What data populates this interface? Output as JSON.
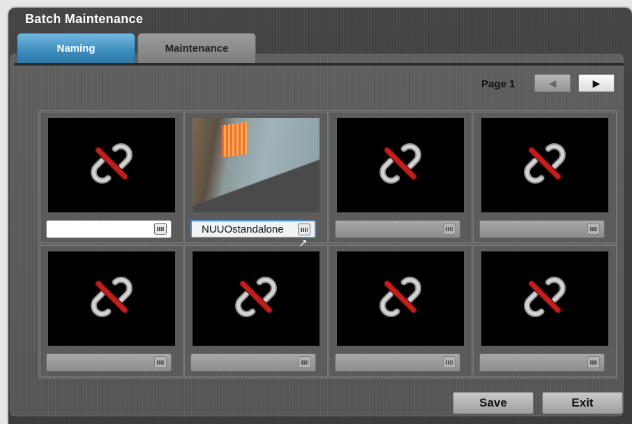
{
  "window": {
    "title": "Batch Maintenance"
  },
  "tabs": [
    {
      "label": "Naming",
      "active": true
    },
    {
      "label": "Maintenance",
      "active": false
    }
  ],
  "pager": {
    "label": "Page 1",
    "prev_icon": "arrow-left-icon",
    "next_icon": "arrow-right-icon"
  },
  "cameras": [
    {
      "name": "",
      "state": "disconnected",
      "field": "active"
    },
    {
      "name": "NUUOstandalone",
      "state": "live",
      "field": "focused"
    },
    {
      "name": "",
      "state": "disconnected",
      "field": "disabled"
    },
    {
      "name": "",
      "state": "disconnected",
      "field": "disabled"
    },
    {
      "name": "",
      "state": "disconnected",
      "field": "disabled"
    },
    {
      "name": "",
      "state": "disconnected",
      "field": "disabled"
    },
    {
      "name": "",
      "state": "disconnected",
      "field": "disabled"
    },
    {
      "name": "",
      "state": "disconnected",
      "field": "disabled"
    }
  ],
  "icons": {
    "disconnected": "broken-link-icon",
    "keyboard": "keyboard-icon"
  },
  "buttons": {
    "save": "Save",
    "exit": "Exit"
  },
  "colors": {
    "active_tab": "#3d8cbd",
    "broken_link": "#c41f1f"
  }
}
